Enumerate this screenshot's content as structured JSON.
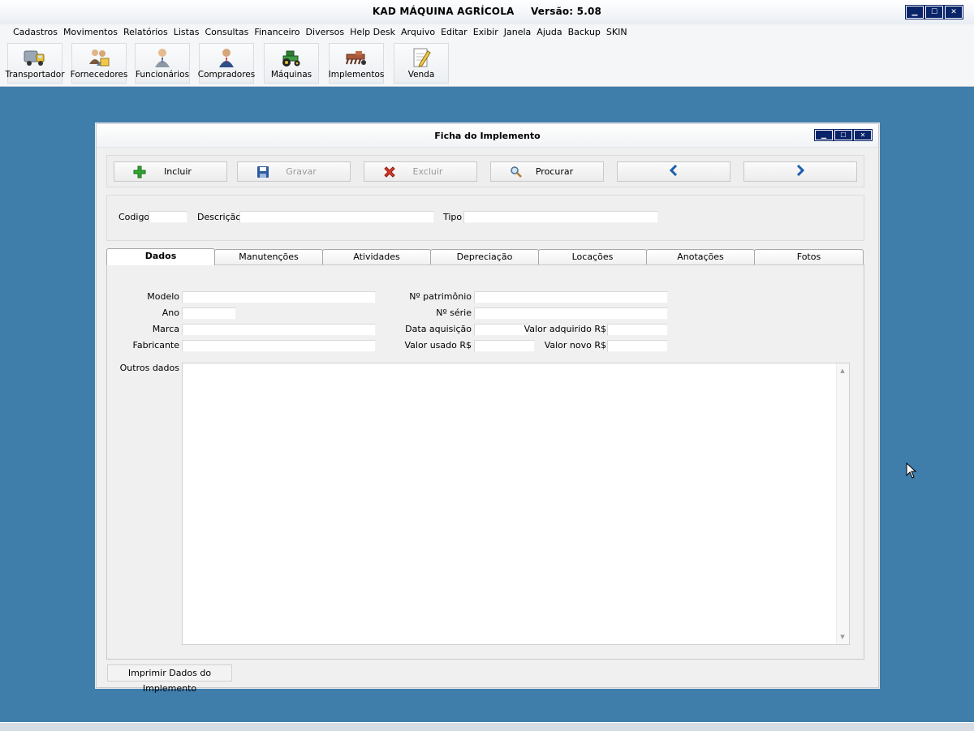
{
  "app": {
    "title": "KAD MÁQUINA AGRÍCOLA",
    "version": "Versão: 5.08"
  },
  "menu": [
    "Cadastros",
    "Movimentos",
    "Relatórios",
    "Listas",
    "Consultas",
    "Financeiro",
    "Diversos",
    "Help Desk",
    "Arquivo",
    "Editar",
    "Exibir",
    "Janela",
    "Ajuda",
    "Backup",
    "SKIN"
  ],
  "toolbar": [
    {
      "label": "Transportador",
      "icon": "truck-icon"
    },
    {
      "label": "Fornecedores",
      "icon": "suppliers-icon"
    },
    {
      "label": "Funcionários",
      "icon": "employee-icon"
    },
    {
      "label": "Compradores",
      "icon": "buyer-icon"
    },
    {
      "label": "Máquinas",
      "icon": "tractor-icon"
    },
    {
      "label": "Implementos",
      "icon": "implement-icon"
    },
    {
      "label": "Venda",
      "icon": "sale-notepad-icon"
    }
  ],
  "form": {
    "title": "Ficha do Implemento",
    "actions": {
      "incluir": "Incluir",
      "gravar": "Gravar",
      "excluir": "Excluir",
      "procurar": "Procurar"
    },
    "header": {
      "codigo_label": "Codigo",
      "codigo_value": "",
      "descricao_label": "Descrição",
      "descricao_value": "",
      "tipo_label": "Tipo",
      "tipo_value": ""
    },
    "tabs": [
      "Dados",
      "Manutenções",
      "Atividades",
      "Depreciação",
      "Locações",
      "Anotações",
      "Fotos"
    ],
    "active_tab": "Dados",
    "fields": {
      "modelo": "Modelo",
      "ano": "Ano",
      "marca": "Marca",
      "fabricante": "Fabricante",
      "patrimonio": "Nº patrimônio",
      "serie": "Nº série",
      "data_aquisicao": "Data aquisição",
      "valor_adquirido": "Valor adquirido R$",
      "valor_usado": "Valor usado R$",
      "valor_novo": "Valor novo R$",
      "outros_dados": "Outros dados"
    },
    "print_button": "Imprimir Dados do Implemento"
  },
  "colors": {
    "desktop": "#3f7dab",
    "titlebar_button": "#0a246a",
    "add_green": "#2ea82e",
    "delete_red": "#d83a2a",
    "nav_blue": "#1d5fae"
  }
}
